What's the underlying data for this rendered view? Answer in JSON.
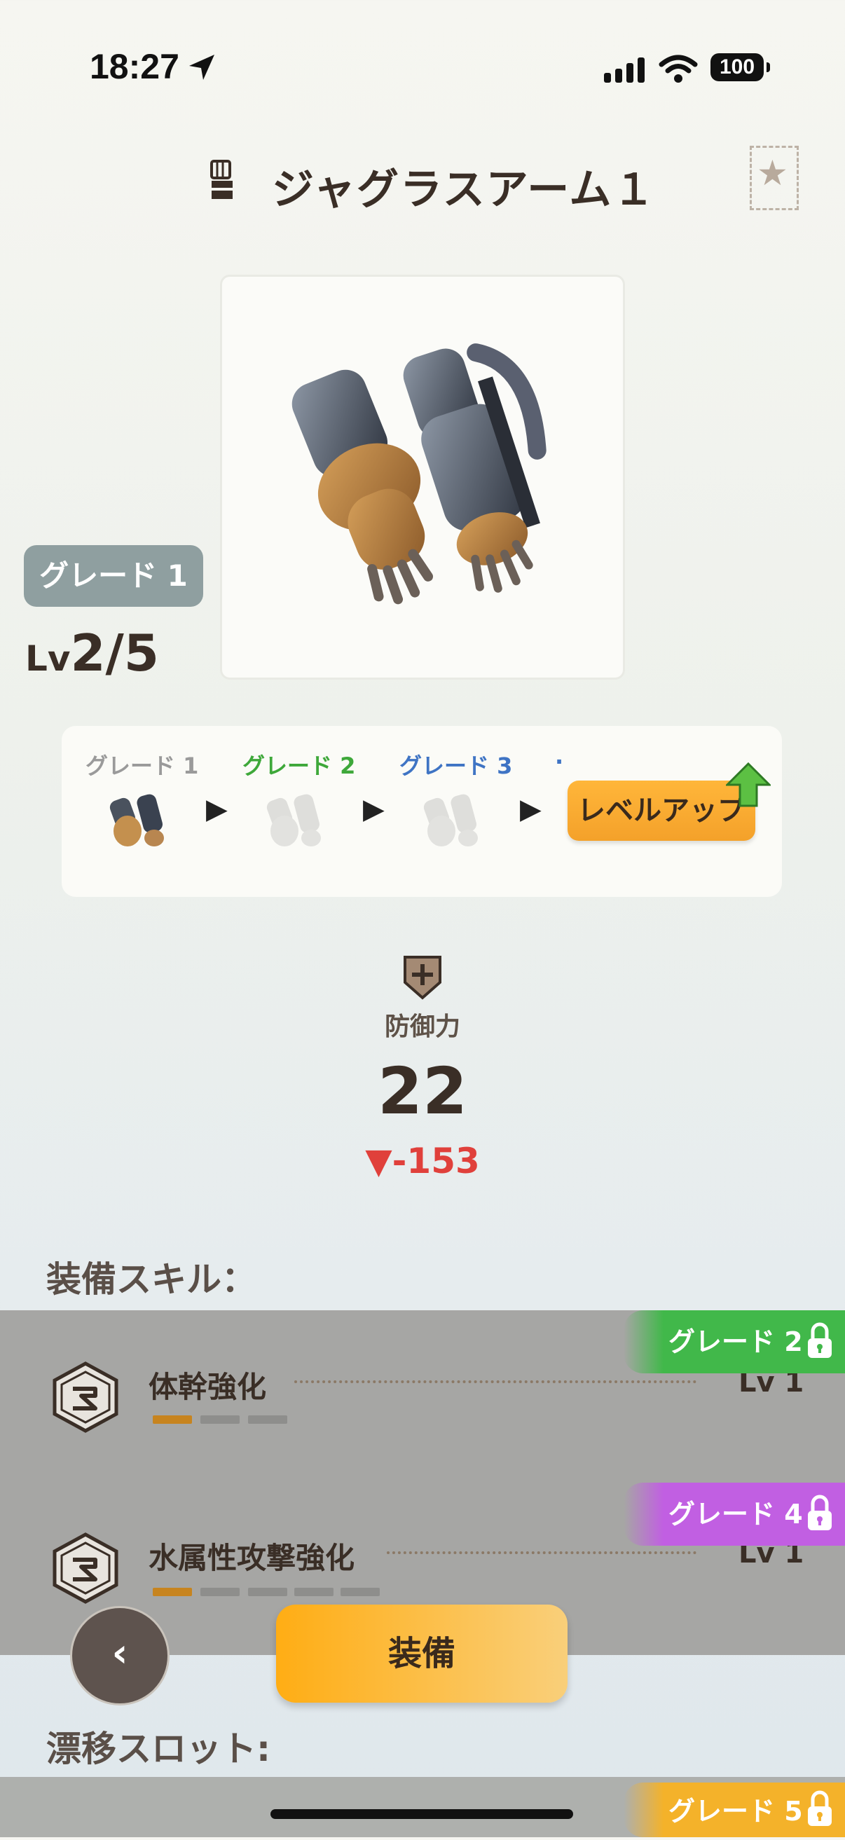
{
  "status": {
    "time": "18:27",
    "battery": "100"
  },
  "header": {
    "title": "ジャグラスアーム１",
    "item_icon": "gauntlet-icon",
    "bookmark_icon": "star-icon"
  },
  "item": {
    "grade": "グレード 1",
    "level_prefix": "Lv",
    "level": "2/5",
    "image": "gauntlet-armor-image"
  },
  "grade_path": {
    "grades": [
      {
        "label": "グレード 1",
        "color": "#9a9a9a"
      },
      {
        "label": "グレード 2",
        "color": "#3ea83a"
      },
      {
        "label": "グレード 3",
        "color": "#3f74c4"
      }
    ],
    "more": "·",
    "level_up_label": "レベルアップ"
  },
  "defense": {
    "label": "防御力",
    "value": "22",
    "diff": "▼-153"
  },
  "skills": {
    "title": "装備スキル：",
    "items": [
      {
        "name": "体幹強化",
        "level": "Lv 1",
        "grade_lock": "グレード 2",
        "lock_color": "#41b84a",
        "bars_filled": 1,
        "bars_total": 3
      },
      {
        "name": "水属性攻撃強化",
        "level": "Lv 1",
        "grade_lock": "グレード 4",
        "lock_color": "#c15fe2",
        "bars_filled": 1,
        "bars_total": 5
      }
    ]
  },
  "slots": {
    "title": "漂移スロット:",
    "grade_lock": "グレード 5",
    "lock_color": "#f4b22a"
  },
  "buttons": {
    "back": "‹",
    "equip": "装備"
  }
}
